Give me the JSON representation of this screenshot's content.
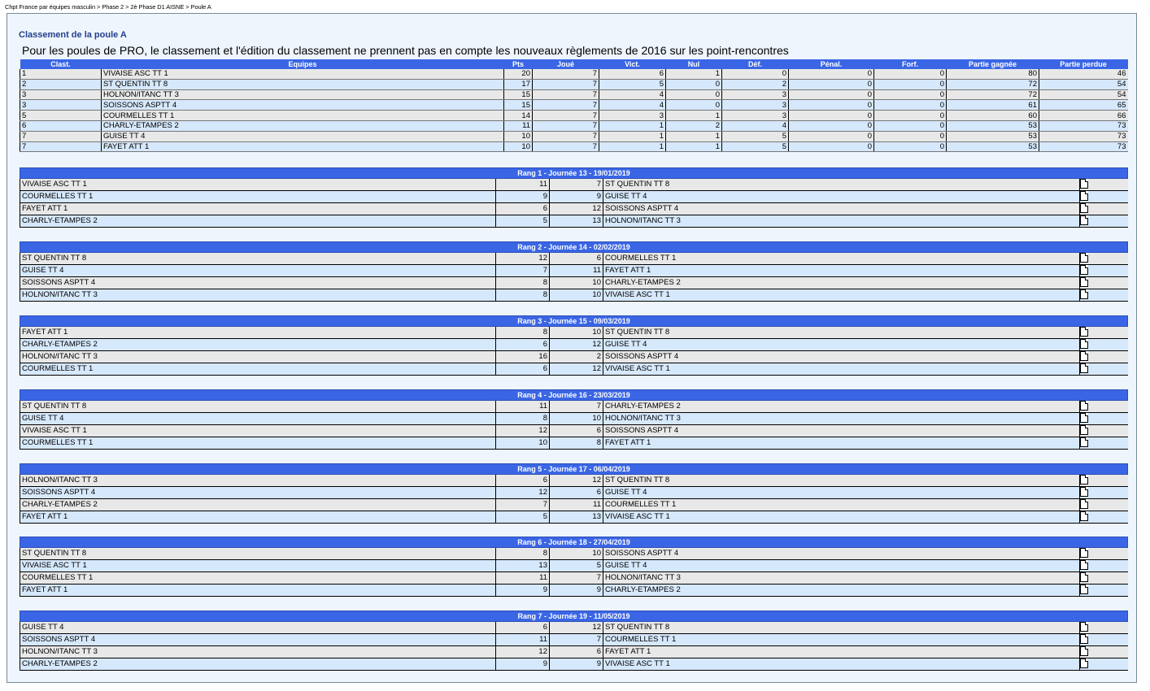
{
  "breadcrumb": [
    "Chpt France par équipes masculin",
    "Phase 2",
    "2è Phase D1 AISNE",
    "Poule A"
  ],
  "breadcrumb_sep": ">",
  "title": "Classement de la poule A",
  "notice": "Pour les poules de PRO, le classement et l'édition du classement ne prennent pas en compte les nouveaux règlements de 2016 sur les point-rencontres",
  "standings": {
    "headers": [
      "Clast.",
      "Equipes",
      "Pts",
      "Joué",
      "Vict.",
      "Nul",
      "Déf.",
      "Pénal.",
      "Forf.",
      "Partie gagnée",
      "Partie perdue"
    ],
    "rows": [
      [
        "1",
        "VIVAISE ASC TT 1",
        "20",
        "7",
        "6",
        "1",
        "0",
        "0",
        "0",
        "80",
        "46"
      ],
      [
        "2",
        "ST QUENTIN TT 8",
        "17",
        "7",
        "5",
        "0",
        "2",
        "0",
        "0",
        "72",
        "54"
      ],
      [
        "3",
        "HOLNON/ITANC TT 3",
        "15",
        "7",
        "4",
        "0",
        "3",
        "0",
        "0",
        "72",
        "54"
      ],
      [
        "3",
        "SOISSONS ASPTT 4",
        "15",
        "7",
        "4",
        "0",
        "3",
        "0",
        "0",
        "61",
        "65"
      ],
      [
        "5",
        "COURMELLES TT 1",
        "14",
        "7",
        "3",
        "1",
        "3",
        "0",
        "0",
        "60",
        "66"
      ],
      [
        "6",
        "CHARLY-ETAMPES 2",
        "11",
        "7",
        "1",
        "2",
        "4",
        "0",
        "0",
        "53",
        "73"
      ],
      [
        "7",
        "GUISE TT 4",
        "10",
        "7",
        "1",
        "1",
        "5",
        "0",
        "0",
        "53",
        "73"
      ],
      [
        "7",
        "FAYET ATT 1",
        "10",
        "7",
        "1",
        "1",
        "5",
        "0",
        "0",
        "53",
        "73"
      ]
    ]
  },
  "rounds": [
    {
      "title": "Rang 1 - Journée 13 - 19/01/2019",
      "matches": [
        [
          "VIVAISE ASC TT 1",
          "11",
          "7",
          "ST QUENTIN TT 8"
        ],
        [
          "COURMELLES TT 1",
          "9",
          "9",
          "GUISE TT 4"
        ],
        [
          "FAYET ATT 1",
          "6",
          "12",
          "SOISSONS ASPTT 4"
        ],
        [
          "CHARLY-ETAMPES 2",
          "5",
          "13",
          "HOLNON/ITANC TT 3"
        ]
      ]
    },
    {
      "title": "Rang 2 - Journée 14 - 02/02/2019",
      "matches": [
        [
          "ST QUENTIN TT 8",
          "12",
          "6",
          "COURMELLES TT 1"
        ],
        [
          "GUISE TT 4",
          "7",
          "11",
          "FAYET ATT 1"
        ],
        [
          "SOISSONS ASPTT 4",
          "8",
          "10",
          "CHARLY-ETAMPES 2"
        ],
        [
          "HOLNON/ITANC TT 3",
          "8",
          "10",
          "VIVAISE ASC TT 1"
        ]
      ]
    },
    {
      "title": "Rang 3 - Journée 15 - 09/03/2019",
      "matches": [
        [
          "FAYET ATT 1",
          "8",
          "10",
          "ST QUENTIN TT 8"
        ],
        [
          "CHARLY-ETAMPES 2",
          "6",
          "12",
          "GUISE TT 4"
        ],
        [
          "HOLNON/ITANC TT 3",
          "16",
          "2",
          "SOISSONS ASPTT 4"
        ],
        [
          "COURMELLES TT 1",
          "6",
          "12",
          "VIVAISE ASC TT 1"
        ]
      ]
    },
    {
      "title": "Rang 4 - Journée 16 - 23/03/2019",
      "matches": [
        [
          "ST QUENTIN TT 8",
          "11",
          "7",
          "CHARLY-ETAMPES 2"
        ],
        [
          "GUISE TT 4",
          "8",
          "10",
          "HOLNON/ITANC TT 3"
        ],
        [
          "VIVAISE ASC TT 1",
          "12",
          "6",
          "SOISSONS ASPTT 4"
        ],
        [
          "COURMELLES TT 1",
          "10",
          "8",
          "FAYET ATT 1"
        ]
      ]
    },
    {
      "title": "Rang 5 - Journée 17 - 06/04/2019",
      "matches": [
        [
          "HOLNON/ITANC TT 3",
          "6",
          "12",
          "ST QUENTIN TT 8"
        ],
        [
          "SOISSONS ASPTT 4",
          "12",
          "6",
          "GUISE TT 4"
        ],
        [
          "CHARLY-ETAMPES 2",
          "7",
          "11",
          "COURMELLES TT 1"
        ],
        [
          "FAYET ATT 1",
          "5",
          "13",
          "VIVAISE ASC TT 1"
        ]
      ]
    },
    {
      "title": "Rang 6 - Journée 18 - 27/04/2019",
      "matches": [
        [
          "ST QUENTIN TT 8",
          "8",
          "10",
          "SOISSONS ASPTT 4"
        ],
        [
          "VIVAISE ASC TT 1",
          "13",
          "5",
          "GUISE TT 4"
        ],
        [
          "COURMELLES TT 1",
          "11",
          "7",
          "HOLNON/ITANC TT 3"
        ],
        [
          "FAYET ATT 1",
          "9",
          "9",
          "CHARLY-ETAMPES 2"
        ]
      ]
    },
    {
      "title": "Rang 7 - Journée 19 - 11/05/2019",
      "matches": [
        [
          "GUISE TT 4",
          "6",
          "12",
          "ST QUENTIN TT 8"
        ],
        [
          "SOISSONS ASPTT 4",
          "11",
          "7",
          "COURMELLES TT 1"
        ],
        [
          "HOLNON/ITANC TT 3",
          "12",
          "6",
          "FAYET ATT 1"
        ],
        [
          "CHARLY-ETAMPES 2",
          "9",
          "9",
          "VIVAISE ASC TT 1"
        ]
      ]
    }
  ],
  "icons": {
    "match_sheet": "document-icon"
  },
  "colors": {
    "header_blue": "#3a66e6",
    "title_blue": "#25408f",
    "row_grey": "#e8e8e8",
    "row_blue": "#d6e8fb"
  }
}
